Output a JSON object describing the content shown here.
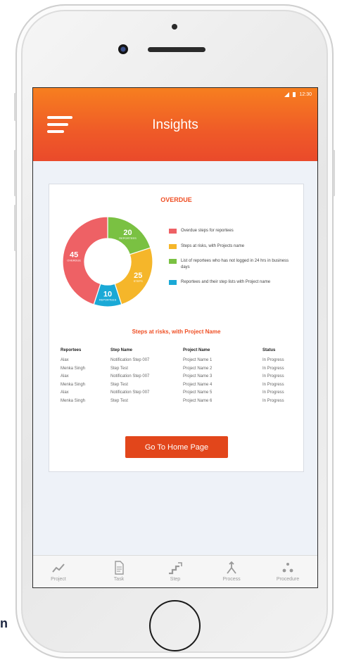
{
  "app": {
    "title": "Insights",
    "status_time": "12:30"
  },
  "edge_text": "n",
  "overdue": {
    "title": "OVERDUE",
    "segments": [
      {
        "value": "20",
        "label": "REPORTEES",
        "color": "#7ac142"
      },
      {
        "value": "25",
        "label": "STEPS",
        "color": "#f5b62a"
      },
      {
        "value": "10",
        "label": "REPORTEES",
        "color": "#1aa9d6"
      },
      {
        "value": "45",
        "label": "OVERDUE",
        "color": "#ee6165"
      }
    ],
    "legend": [
      {
        "text": "Overdue steps for reportees",
        "color": "#ee6165"
      },
      {
        "text": "Steps at risks, with Projects name",
        "color": "#f5b62a"
      },
      {
        "text": "List of reportees who has not logged in 24 hrs in business days",
        "color": "#7ac142"
      },
      {
        "text": "Reportees and their step lists with Project name",
        "color": "#1aa9d6"
      }
    ]
  },
  "risks": {
    "title": "Steps at risks, with Project Name",
    "headers": [
      "Reportees",
      "Step Name",
      "Project Name",
      "Status"
    ],
    "rows": [
      [
        "Alax",
        "Notification Step 007",
        "Project Name 1",
        "In Progress"
      ],
      [
        "Menka Singh",
        "Step Test",
        "Project Name 2",
        "In Progress"
      ],
      [
        "Alax",
        "Notification Step 007",
        "Project Name 3",
        "In Progress"
      ],
      [
        "Menka Singh",
        "Step Test",
        "Project Name 4",
        "In Progress"
      ],
      [
        "Alax",
        "Notification Step 007",
        "Project Name 5",
        "In Progress"
      ],
      [
        "Menka Singh",
        "Step Test",
        "Project Name 6",
        "In Progress"
      ]
    ]
  },
  "home_button": "Go To Home Page",
  "nav": [
    {
      "label": "Project",
      "icon": "trend-line-icon"
    },
    {
      "label": "Task",
      "icon": "document-icon"
    },
    {
      "label": "Step",
      "icon": "stairs-icon"
    },
    {
      "label": "Process",
      "icon": "merge-arrow-icon"
    },
    {
      "label": "Procedure",
      "icon": "dots-icon"
    }
  ]
}
